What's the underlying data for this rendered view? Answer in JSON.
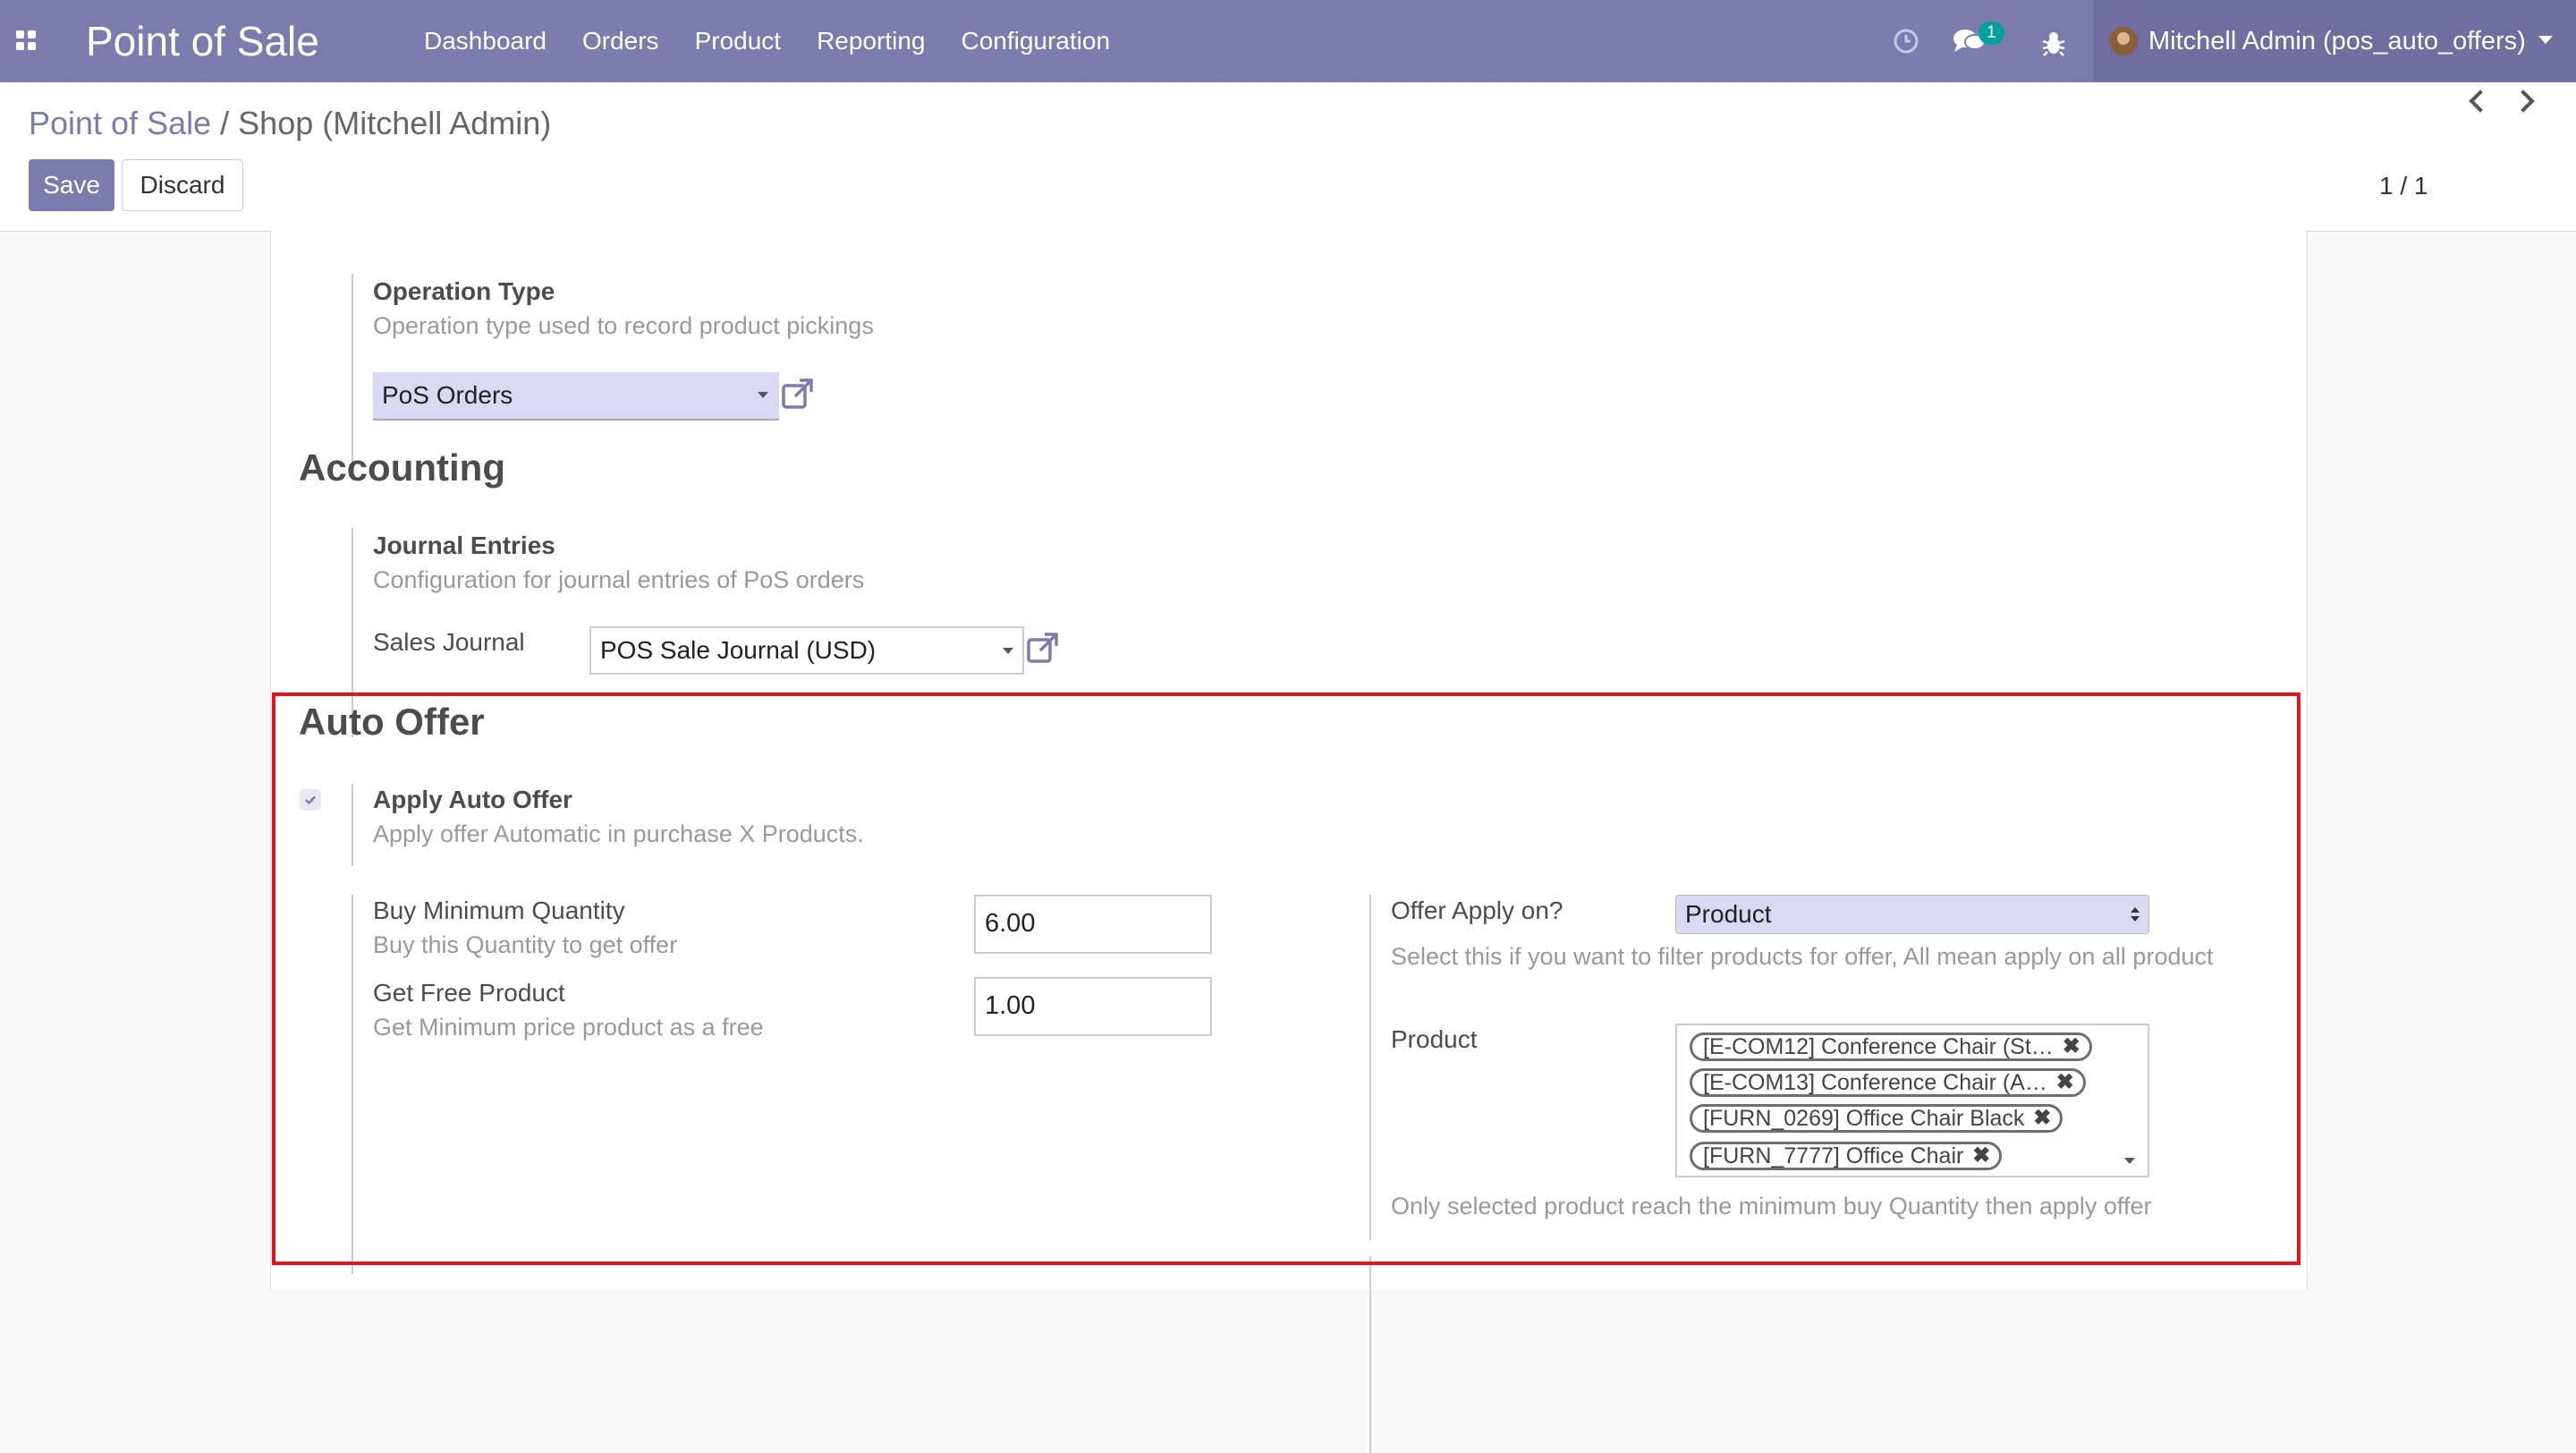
{
  "navbar": {
    "brand": "Point of Sale",
    "menu": [
      "Dashboard",
      "Orders",
      "Product",
      "Reporting",
      "Configuration"
    ],
    "chat_badge": "1",
    "user": "Mitchell Admin (pos_auto_offers)"
  },
  "control": {
    "breadcrumb_root": "Point of Sale",
    "breadcrumb_sep": "/",
    "breadcrumb_current": "Shop (Mitchell Admin)",
    "save_label": "Save",
    "discard_label": "Discard",
    "pager": "1 / 1"
  },
  "inventory": {
    "operation_type_label": "Operation Type",
    "operation_type_desc": "Operation type used to record product pickings",
    "operation_type_value": "PoS Orders"
  },
  "accounting": {
    "title": "Accounting",
    "journal_entries_label": "Journal Entries",
    "journal_entries_desc": "Configuration for journal entries of PoS orders",
    "sales_journal_label": "Sales Journal",
    "sales_journal_value": "POS Sale Journal (USD)"
  },
  "auto_offer": {
    "title": "Auto Offer",
    "apply_label": "Apply Auto Offer",
    "apply_desc": "Apply offer Automatic in purchase X Products.",
    "apply_checked": true,
    "buy_min_label": "Buy Minimum Quantity",
    "buy_min_desc": "Buy this Quantity to get offer",
    "buy_min_value": "6.00",
    "free_label": "Get Free Product",
    "free_desc": "Get Minimum price product as a free",
    "free_value": "1.00",
    "apply_on_label": "Offer Apply on?",
    "apply_on_value": "Product",
    "apply_on_desc": "Select this if you want to filter products for offer, All mean apply on all product",
    "product_label": "Product",
    "products": [
      "[E-COM12] Conference Chair (St…",
      "[E-COM13] Conference Chair (A…",
      "[FURN_0269] Office Chair Black",
      "[FURN_7777] Office Chair"
    ],
    "product_desc": "Only selected product reach the minimum buy Quantity then apply offer"
  },
  "colors": {
    "brand": "#7c7bad",
    "highlight_border": "#e2141c",
    "badge": "#00a09d"
  }
}
